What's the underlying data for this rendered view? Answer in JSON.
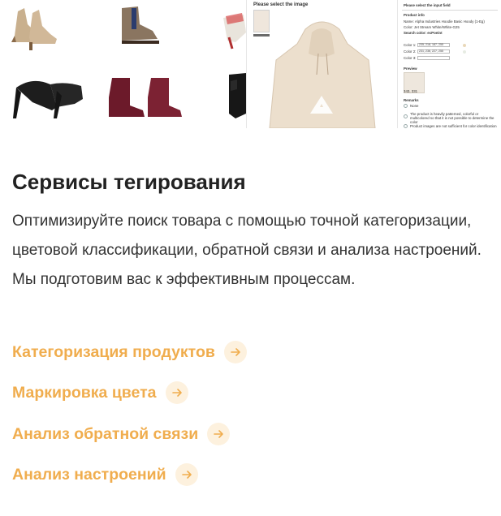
{
  "hero": {
    "image_picker": {
      "title": "Please select the image"
    },
    "input_panel": {
      "title": "Please select the input field",
      "product_info_label": "Product info",
      "name_line": "Name: Alpha Industries Hoodie Basic Hoody (1-Eg)",
      "color_line": "Color: Jet Stream White/White-G25",
      "search_color_line": "Search color: ecPoeint",
      "color_rows": [
        {
          "label": "Color 1:",
          "value": "235, 218, 187, 255"
        },
        {
          "label": "Color 2:",
          "value": "231, 236, 227, 255"
        },
        {
          "label": "Color 3:",
          "value": ""
        }
      ],
      "preview_label": "Preview",
      "preview_code": "343, 331",
      "remarks_label": "Remarks",
      "remarks": [
        "None",
        "The product is heavily patterned, colorful or multicolored so that it is not possible to determine the color",
        "Product images are not sufficient for color identification"
      ]
    }
  },
  "content": {
    "title": "Сервисы тегирования",
    "description": "Оптимизируйте поиск товара с помощью точной категоризации, цветовой классификации, обратной связи и анализа настроений. Мы подготовим вас к эффективным процессам.",
    "links": [
      {
        "label": "Категоризация продуктов"
      },
      {
        "label": "Маркировка цвета"
      },
      {
        "label": "Анализ обратной связи"
      },
      {
        "label": "Анализ настроений"
      }
    ],
    "accent_color": "#f0ad4e",
    "arrow_bg": "#fdf1de"
  }
}
